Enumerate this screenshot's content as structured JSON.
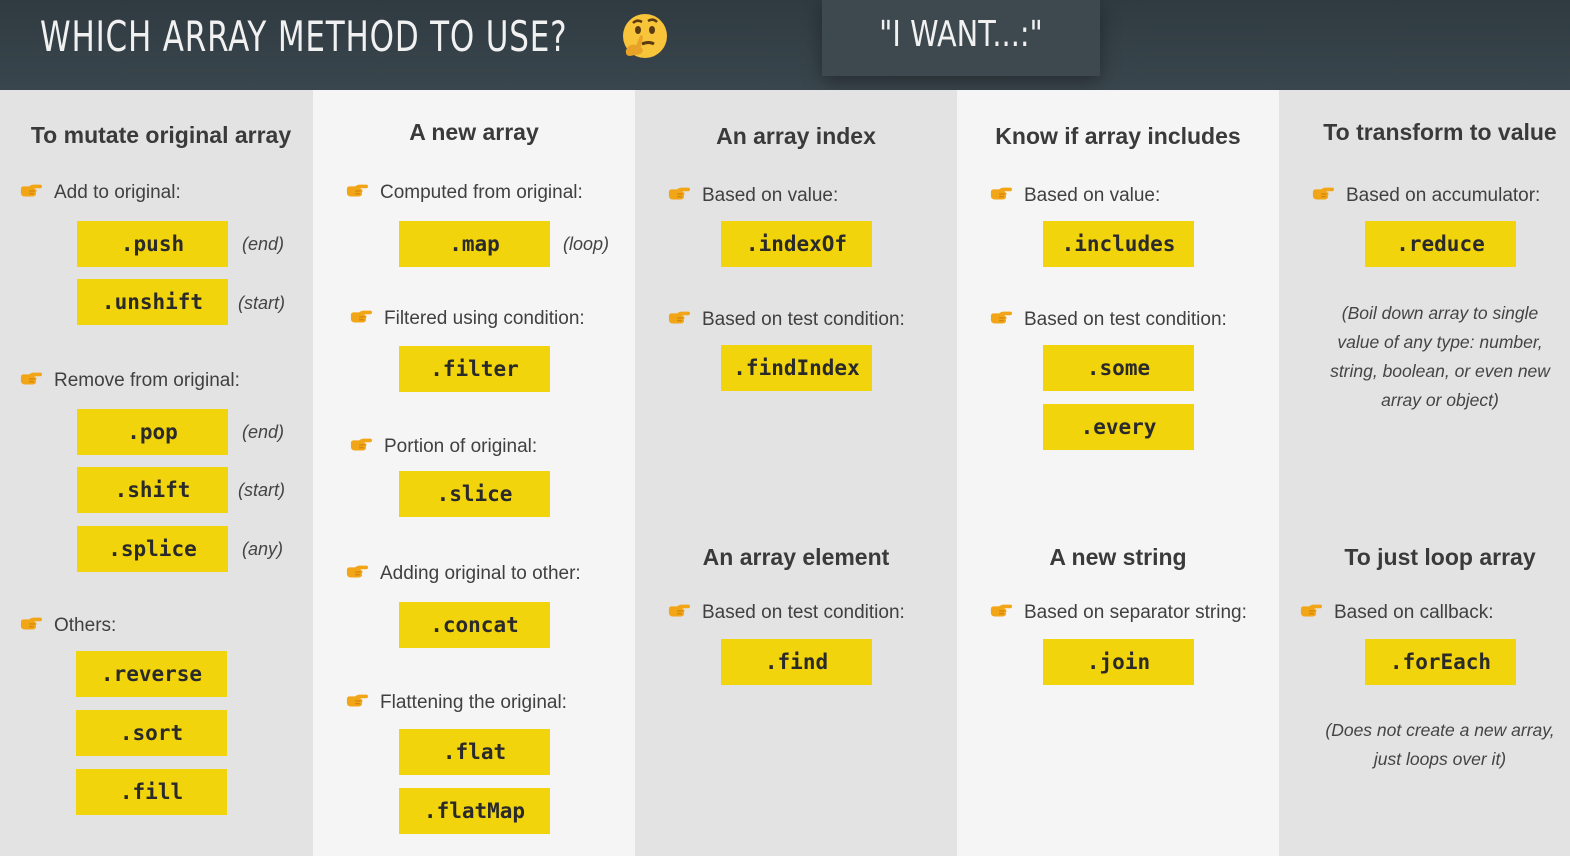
{
  "header": {
    "title": "WHICH ARRAY METHOD TO USE?",
    "emoji": "thinking-face-icon",
    "want": "\"I WANT...:\""
  },
  "colors": {
    "method_bg": "#f2d40c",
    "header_bg": "#2f3a41",
    "bullet": "#f2a516"
  },
  "col1": {
    "heading": "To mutate original array",
    "add": "Add to original:",
    "push": ".push",
    "push_note": "(end)",
    "unshift": ".unshift",
    "unshift_note": "(start)",
    "remove": "Remove from original:",
    "pop": ".pop",
    "pop_note": "(end)",
    "shift": ".shift",
    "shift_note": "(start)",
    "splice": ".splice",
    "splice_note": "(any)",
    "others": "Others:",
    "reverse": ".reverse",
    "sort": ".sort",
    "fill": ".fill"
  },
  "col2": {
    "heading": "A new array",
    "computed": "Computed from original:",
    "map": ".map",
    "map_note": "(loop)",
    "filtered": "Filtered using condition:",
    "filter": ".filter",
    "portion": "Portion of original:",
    "slice": ".slice",
    "adding": "Adding original to other:",
    "concat": ".concat",
    "flattening": "Flattening the original:",
    "flat": ".flat",
    "flatMap": ".flatMap"
  },
  "col3": {
    "heading": "An array index",
    "by_value": "Based on value:",
    "indexOf": ".indexOf",
    "by_test": "Based on test condition:",
    "findIndex": ".findIndex",
    "heading2": "An array element",
    "by_test2": "Based on test condition:",
    "find": ".find"
  },
  "col4": {
    "heading": "Know if array includes",
    "by_value": "Based on value:",
    "includes": ".includes",
    "by_test": "Based on test condition:",
    "some": ".some",
    "every": ".every",
    "heading2": "A new string",
    "by_sep": "Based on separator string:",
    "join": ".join"
  },
  "col5": {
    "heading": "To transform to value",
    "by_acc": "Based on accumulator:",
    "reduce": ".reduce",
    "reduce_l1": "(Boil down array to single",
    "reduce_l2": "value of any type: number,",
    "reduce_l3": "string, boolean, or even new",
    "reduce_l4": "array or object)",
    "heading2": "To just loop array",
    "by_cb": "Based on callback:",
    "forEach": ".forEach",
    "forEach_l1": "(Does not create a new array,",
    "forEach_l2": "just loops over it)"
  }
}
